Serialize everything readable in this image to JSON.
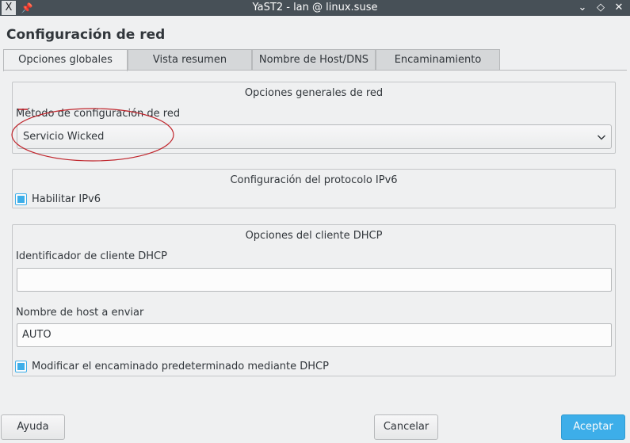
{
  "window": {
    "title": "YaST2 - lan @ linux.suse",
    "app_icon_glyph": "X",
    "pin_glyph": "📌",
    "minimize_glyph": "⌄",
    "maximize_glyph": "◇",
    "close_glyph": "✕"
  },
  "page": {
    "title": "Configuración de red"
  },
  "tabs": [
    {
      "label": "Opciones globales",
      "active": true
    },
    {
      "label": "Vista resumen",
      "active": false
    },
    {
      "label": "Nombre de Host/DNS",
      "active": false
    },
    {
      "label": "Encaminamiento",
      "active": false
    }
  ],
  "general": {
    "title": "Opciones generales de red",
    "method_label": "Método de configuración de red",
    "method_value": "Servicio Wicked"
  },
  "ipv6": {
    "title": "Configuración del protocolo IPv6",
    "enable_label": "Habilitar IPv6",
    "enable_checked": true
  },
  "dhcp": {
    "title": "Opciones del cliente DHCP",
    "client_id_label": "Identificador de cliente DHCP",
    "client_id_value": "",
    "hostname_label": "Nombre de host a enviar",
    "hostname_value": "AUTO",
    "default_route_label": "Modificar el encaminado predeterminado mediante DHCP",
    "default_route_checked": true
  },
  "buttons": {
    "help": "Ayuda",
    "cancel": "Cancelar",
    "accept": "Aceptar"
  },
  "colors": {
    "accent": "#3daee9",
    "titlebar": "#475057",
    "annotation": "#c0262d"
  }
}
